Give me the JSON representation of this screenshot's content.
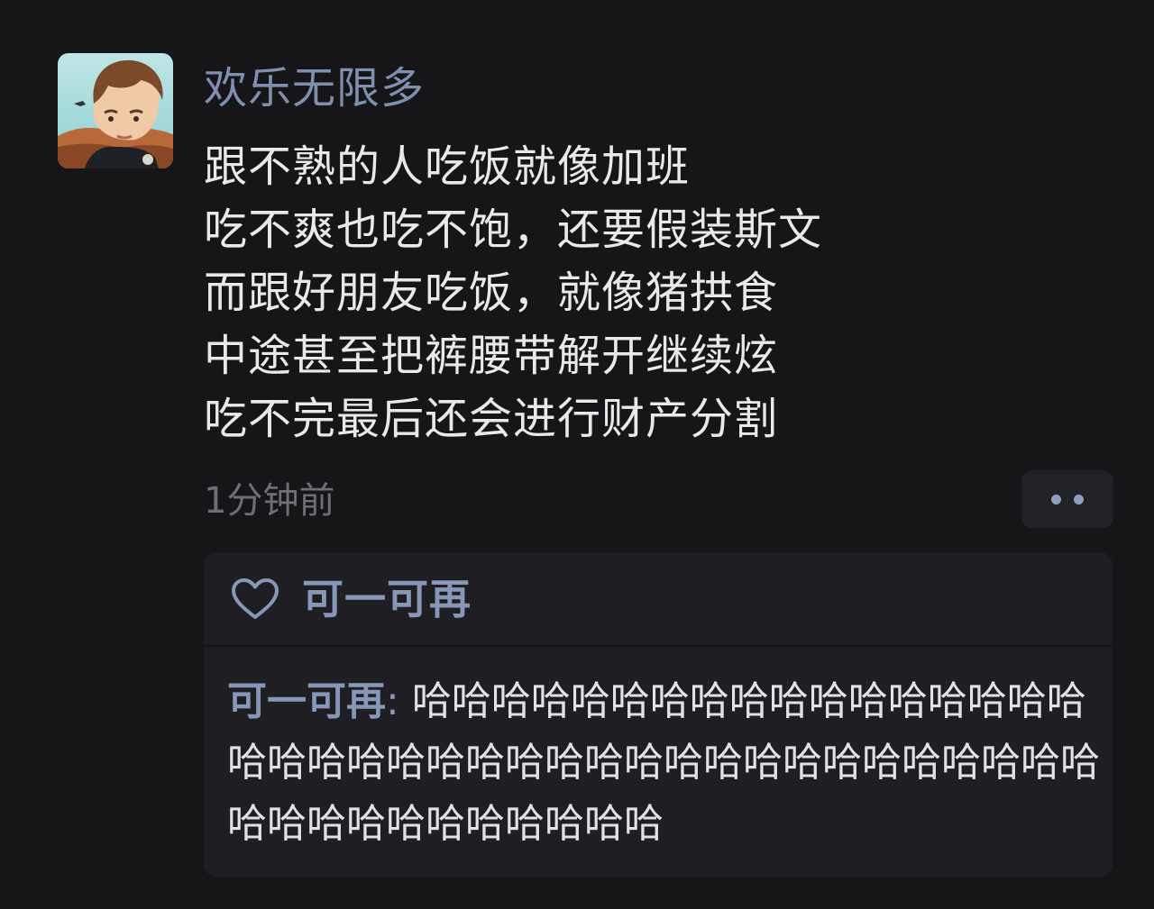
{
  "post": {
    "author": "欢乐无限多",
    "lines": [
      "跟不熟的人吃饭就像加班",
      "吃不爽也吃不饱，还要假装斯文",
      "而跟好朋友吃饭，就像猪拱食",
      "中途甚至把裤腰带解开继续炫",
      "吃不完最后还会进行财产分割"
    ],
    "time": "1分钟前"
  },
  "likes": {
    "names": "可一可再"
  },
  "comments": [
    {
      "author": "可一可再",
      "separator": ": ",
      "text": "哈哈哈哈哈哈哈哈哈哈哈哈哈哈哈哈哈哈哈哈哈哈哈哈哈哈哈哈哈哈哈哈哈哈哈哈哈哈哈哈哈哈哈哈哈哈哈哈哈哈"
    }
  ],
  "icons": {
    "like": "heart-icon",
    "more": "more-dots-icon"
  },
  "colors": {
    "background": "#161618",
    "name_link": "#7f8fae",
    "body_text": "#e9e9ec",
    "timestamp": "#6e6e74",
    "panel": "#1f1f23"
  }
}
